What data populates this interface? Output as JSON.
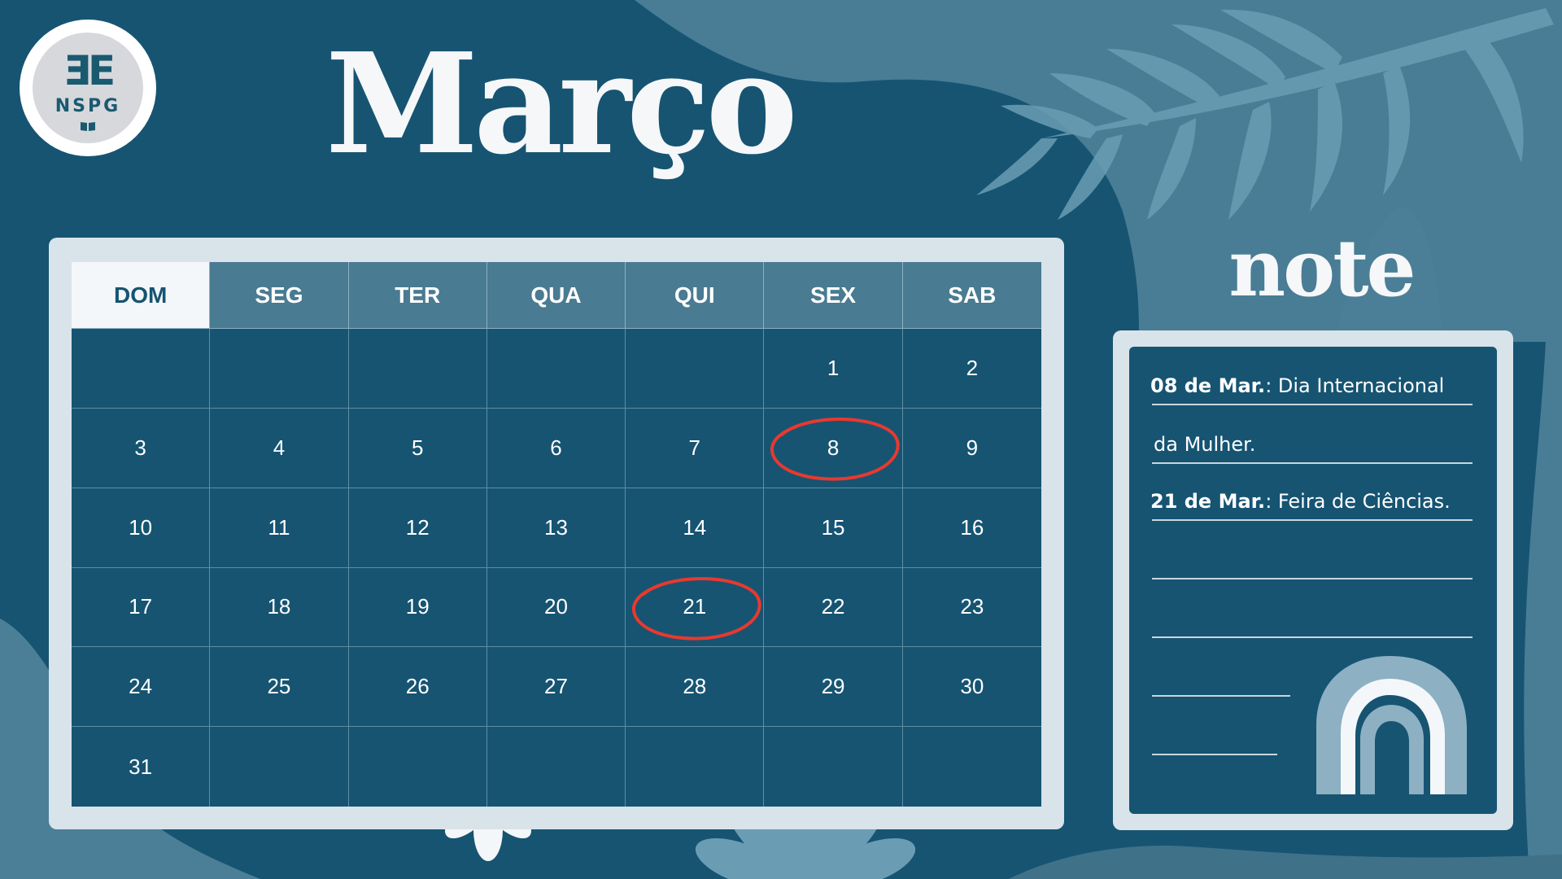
{
  "logo": {
    "mark": "ƎE",
    "text": "NSPG"
  },
  "month_title": "Março",
  "calendar": {
    "weekdays": [
      "DOM",
      "SEG",
      "TER",
      "QUA",
      "QUI",
      "SEX",
      "SAB"
    ],
    "active_weekday": "DOM",
    "weeks": [
      [
        "",
        "",
        "",
        "",
        "",
        "1",
        "2"
      ],
      [
        "3",
        "4",
        "5",
        "6",
        "7",
        "8",
        "9"
      ],
      [
        "10",
        "11",
        "12",
        "13",
        "14",
        "15",
        "16"
      ],
      [
        "17",
        "18",
        "19",
        "20",
        "21",
        "22",
        "23"
      ],
      [
        "24",
        "25",
        "26",
        "27",
        "28",
        "29",
        "30"
      ],
      [
        "31",
        "",
        "",
        "",
        "",
        "",
        ""
      ]
    ],
    "circled_days": [
      "8",
      "21"
    ]
  },
  "note": {
    "title": "note",
    "entries": [
      {
        "date": "08 de Mar.",
        "text": ": Dia Internacional"
      },
      {
        "date": "",
        "text": "da Mulher."
      },
      {
        "date": "21 de Mar.",
        "text": ": Feira de Ciências."
      }
    ]
  },
  "colors": {
    "background": "#165472",
    "frame": "#d9e3ea",
    "header": "#497b92",
    "accent_light": "#5f90a8",
    "circle": "#e8392f",
    "text_light": "#ffffff"
  }
}
